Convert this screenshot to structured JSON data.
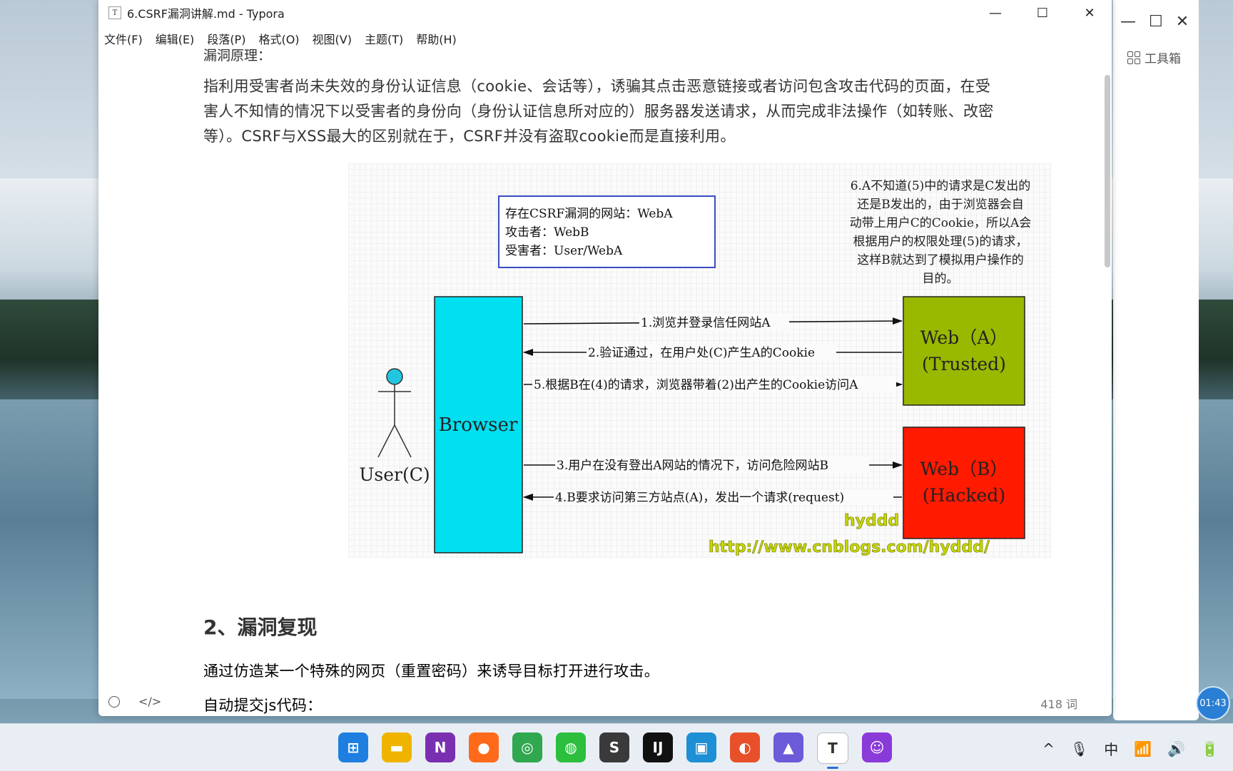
{
  "window": {
    "title": "6.CSRF漏洞讲解.md - Typora",
    "icon_letter": "T",
    "minimize": "—",
    "maximize": "☐",
    "close": "✕"
  },
  "menu": [
    "文件(F)",
    "编辑(E)",
    "段落(P)",
    "格式(O)",
    "视图(V)",
    "主题(T)",
    "帮助(H)"
  ],
  "doc": {
    "partial_heading": "漏洞原理：",
    "paragraph1": "指利用受害者尚未失效的身份认证信息（cookie、会话等），诱骗其点击恶意链接或者访问包含攻击代码的页面，在受害人不知情的情况下以受害者的身份向（身份认证信息所对应的）服务器发送请求，从而完成非法操作（如转账、改密等）。CSRF与XSS最大的区别就在于，CSRF并没有盗取cookie而是直接利用。",
    "heading2": "2、漏洞复现",
    "paragraph2": "通过仿造某一个特殊的网页（重置密码）来诱导目标打开进行攻击。",
    "paragraph3": "自动提交js代码："
  },
  "diagram": {
    "info_line1": "存在CSRF漏洞的网站：WebA",
    "info_line2": "攻击者：WebB",
    "info_line3": "受害者：User/WebA",
    "note_lines": [
      "6.A不知道(5)中的请求是C发出的",
      "还是B发出的，由于浏览器会自",
      "动带上用户C的Cookie，所以A会",
      "根据用户的权限处理(5)的请求，",
      "这样B就达到了模拟用户操作的",
      "目的。"
    ],
    "browser_label": "Browser",
    "user_label": "User(C)",
    "web_a_line1": "Web（A）",
    "web_a_line2": "(Trusted)",
    "web_b_line1": "Web（B）",
    "web_b_line2": "(Hacked)",
    "arrow1": "1.浏览并登录信任网站A",
    "arrow2": "2.验证通过，在用户处(C)产生A的Cookie",
    "arrow5": "5.根据B在(4)的请求，浏览器带着(2)出产生的Cookie访问A",
    "arrow3": "3.用户在没有登出A网站的情况下，访问危险网站B",
    "arrow4": "4.B要求访问第三方站点(A)，发出一个请求(request)",
    "watermark1": "hyddd",
    "watermark2": "http://www.cnblogs.com/hyddd/",
    "colors": {
      "browser": "#00e0f0",
      "web_a": "#99b800",
      "web_b": "#ff1a00",
      "watermark": "#c8d800"
    }
  },
  "status": {
    "word_count": "418 词"
  },
  "side_app": {
    "tools_label": "工具箱",
    "clock": "01:43"
  },
  "taskbar": {
    "apps": [
      {
        "name": "start-icon",
        "color": "#1e7fe0",
        "glyph": "⊞"
      },
      {
        "name": "file-explorer-icon",
        "color": "#f0b400",
        "glyph": "▬"
      },
      {
        "name": "onenote-icon",
        "color": "#7a2fb0",
        "glyph": "N"
      },
      {
        "name": "firefox-icon",
        "color": "#ff6a1a",
        "glyph": "●"
      },
      {
        "name": "chrome-icon",
        "color": "#2fa84f",
        "glyph": "◎"
      },
      {
        "name": "wechat-icon",
        "color": "#2bbf3d",
        "glyph": "◍"
      },
      {
        "name": "sublime-icon",
        "color": "#3a3a3a",
        "glyph": "S"
      },
      {
        "name": "intellij-icon",
        "color": "#111111",
        "glyph": "IJ"
      },
      {
        "name": "remote-desktop-icon",
        "color": "#1e8fd4",
        "glyph": "▣"
      },
      {
        "name": "app-spiral-icon",
        "color": "#e8502a",
        "glyph": "◐"
      },
      {
        "name": "app-photo-icon",
        "color": "#6b5bd8",
        "glyph": "▲"
      },
      {
        "name": "typora-icon",
        "color": "#ffffff",
        "glyph": "T",
        "active": true
      },
      {
        "name": "app-face-icon",
        "color": "#8a3ad8",
        "glyph": "☺"
      }
    ],
    "tray": [
      "^",
      "🎙",
      "中",
      "📶",
      "🔊",
      "🔋"
    ]
  }
}
